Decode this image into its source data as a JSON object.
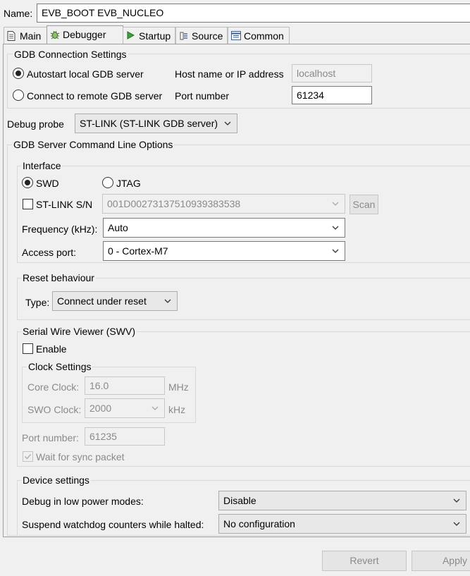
{
  "name_label": "Name:",
  "name_value": "EVB_BOOT EVB_NUCLEO",
  "tabs": [
    {
      "label": "Main",
      "icon": "document-icon"
    },
    {
      "label": "Debugger",
      "icon": "bug-icon"
    },
    {
      "label": "Startup",
      "icon": "play-icon"
    },
    {
      "label": "Source",
      "icon": "source-icon"
    },
    {
      "label": "Common",
      "icon": "window-icon"
    }
  ],
  "gdb": {
    "title": "GDB Connection Settings",
    "autostart_label": "Autostart local GDB server",
    "remote_label": "Connect to remote GDB server",
    "host_label": "Host name or IP address",
    "host_value": "localhost",
    "port_label": "Port number",
    "port_value": "61234",
    "selected": "autostart"
  },
  "probe": {
    "label": "Debug probe",
    "value": "ST-LINK (ST-LINK GDB server)"
  },
  "server_options_title": "GDB Server Command Line Options",
  "interface": {
    "title": "Interface",
    "swd_label": "SWD",
    "jtag_label": "JTAG",
    "selected": "SWD",
    "stlink_sn_label": "ST-LINK S/N",
    "stlink_sn_value": "001D00273137510939383538",
    "scan_label": "Scan",
    "frequency_label": "Frequency (kHz):",
    "frequency_value": "Auto",
    "access_port_label": "Access port:",
    "access_port_value": "0 - Cortex-M7"
  },
  "reset": {
    "title": "Reset behaviour",
    "type_label": "Type:",
    "type_value": "Connect under reset"
  },
  "swv": {
    "title": "Serial Wire Viewer (SWV)",
    "enable_label": "Enable",
    "clock_title": "Clock Settings",
    "core_clock_label": "Core Clock:",
    "core_clock_value": "16.0",
    "core_clock_unit": "MHz",
    "swo_clock_label": "SWO Clock:",
    "swo_clock_value": "2000",
    "swo_clock_unit": "kHz",
    "port_label": "Port number:",
    "port_value": "61235",
    "wait_sync_label": "Wait for sync packet"
  },
  "device": {
    "title": "Device settings",
    "low_power_label": "Debug in low power modes:",
    "low_power_value": "Disable",
    "watchdog_label": "Suspend watchdog counters while halted:",
    "watchdog_value": "No configuration"
  },
  "buttons": {
    "revert": "Revert",
    "apply": "Apply"
  }
}
